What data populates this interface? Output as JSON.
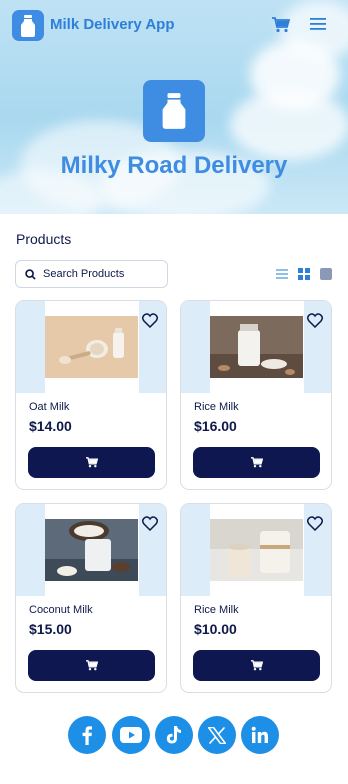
{
  "header": {
    "app_title": "Milk Delivery App",
    "hero_title": "Milky Road Delivery"
  },
  "products_section": {
    "title": "Products",
    "search_placeholder": "Search Products"
  },
  "products": [
    {
      "name": "Oat Milk",
      "price": "$14.00"
    },
    {
      "name": "Rice Milk",
      "price": "$16.00"
    },
    {
      "name": "Coconut Milk",
      "price": "$15.00"
    },
    {
      "name": "Rice Milk",
      "price": "$10.00"
    }
  ],
  "social": [
    "facebook-icon",
    "youtube-icon",
    "tiktok-icon",
    "x-icon",
    "linkedin-icon"
  ],
  "colors": {
    "brand_blue": "#3f8de3",
    "dark_navy": "#0e1750",
    "social_blue": "#1e8fe6",
    "image_stripe": "#dcecf8"
  }
}
